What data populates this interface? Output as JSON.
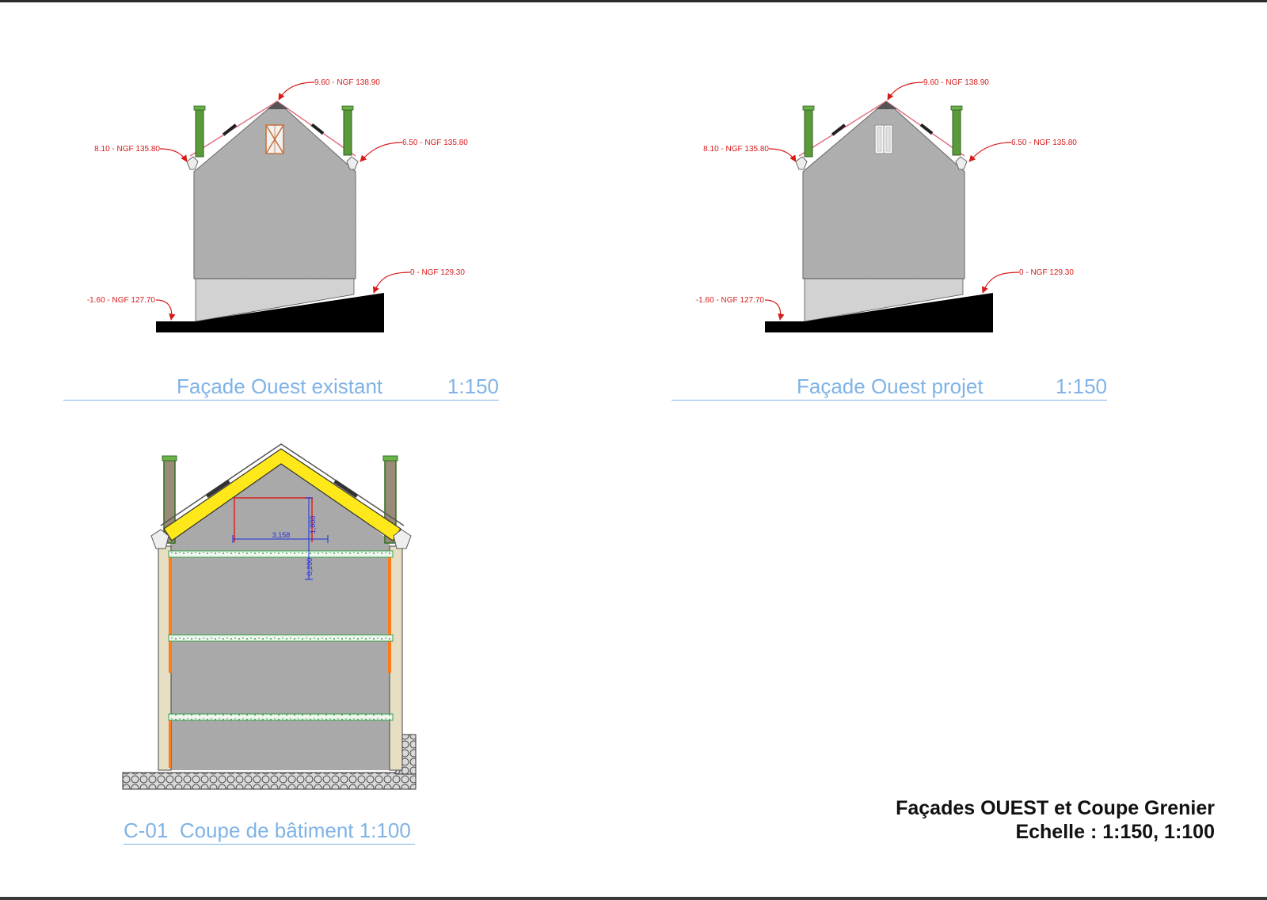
{
  "views": [
    {
      "id": "facade-existant",
      "caption": "Façade Ouest existant",
      "scale": "1:150",
      "levels": {
        "ridge": "9.60 - NGF 138.90",
        "eave_left": "8.10 - NGF 135.80",
        "eave_right": "6.50 - NGF 135.80",
        "ground_right": "0 - NGF 129.30",
        "ground_left": "-1.60 - NGF 127.70"
      },
      "gable_opening": "shutter-x"
    },
    {
      "id": "facade-projet",
      "caption": "Façade Ouest projet",
      "scale": "1:150",
      "levels": {
        "ridge": "9.60 - NGF 138.90",
        "eave_left": "8.10 - NGF 135.80",
        "eave_right": "6.50 - NGF 135.80",
        "ground_right": "0 - NGF 129.30",
        "ground_left": "-1.60 - NGF 127.70"
      },
      "gable_opening": "window"
    },
    {
      "id": "coupe-c01",
      "caption_code": "C-01",
      "caption": "Coupe de bâtiment 1:100",
      "dimensions": {
        "width": "3,158",
        "height": "1,800",
        "floor_thickness": "0,200"
      }
    }
  ],
  "title_block": {
    "line1": "Façades OUEST et Coupe Grenier",
    "line2": "Echelle : 1:150, 1:100"
  },
  "colors": {
    "elevation_marks": "#d71a1a",
    "captions": "#7fb3e6",
    "dimensions": "#1d2fe0",
    "insulation": "#ffe81a",
    "chimney": "#5a9a3a",
    "wall": "#9a9a9a",
    "ground": "#000000"
  }
}
